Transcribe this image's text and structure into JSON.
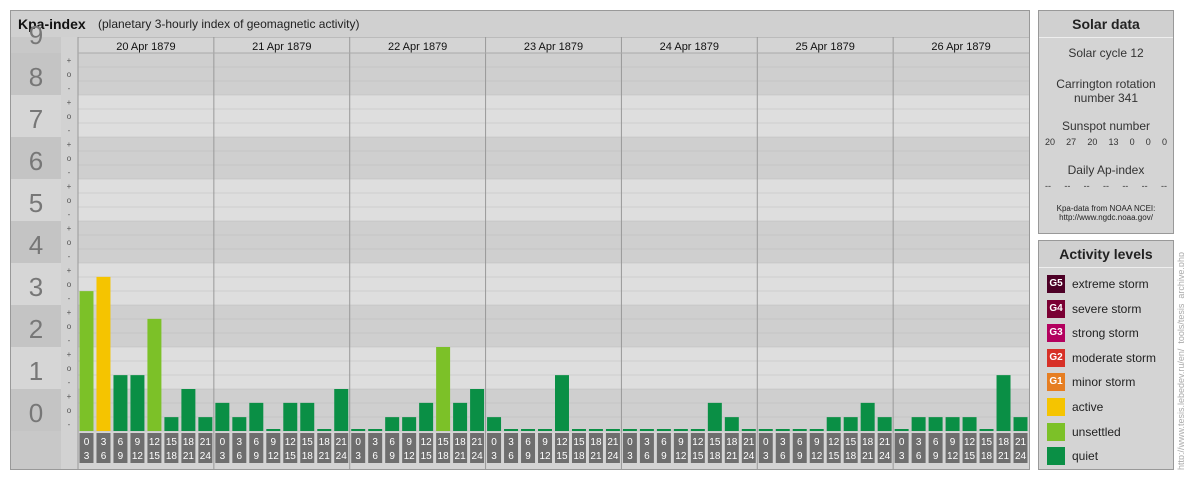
{
  "header": {
    "title": "Kpa-index",
    "subtitle": "(planetary 3-hourly index of geomagnetic activity)"
  },
  "solar": {
    "title": "Solar data",
    "cycle": "Solar cycle 12",
    "rotation_line1": "Carrington rotation",
    "rotation_line2": "number 341",
    "sunspot_title": "Sunspot number",
    "sunspot_values": [
      "20",
      "27",
      "20",
      "13",
      "0",
      "0",
      "0"
    ],
    "ap_title": "Daily Ap-index",
    "ap_values": [
      "--",
      "--",
      "--",
      "--",
      "--",
      "--",
      "--"
    ],
    "source_line1": "Kpa-data from NOAA NCEI:",
    "source_line2": "http://www.ngdc.noaa.gov/"
  },
  "legend": {
    "title": "Activity levels",
    "items": [
      {
        "code": "G5",
        "label": "extreme storm",
        "color": "#4d0026"
      },
      {
        "code": "G4",
        "label": "severe storm",
        "color": "#7a0033"
      },
      {
        "code": "G3",
        "label": "strong storm",
        "color": "#b3005e"
      },
      {
        "code": "G2",
        "label": "moderate storm",
        "color": "#d73027"
      },
      {
        "code": "G1",
        "label": "minor storm",
        "color": "#e67e22"
      },
      {
        "code": "",
        "label": "active",
        "color": "#f5c400"
      },
      {
        "code": "",
        "label": "unsettled",
        "color": "#7cc128"
      },
      {
        "code": "",
        "label": "quiet",
        "color": "#0a8f45"
      }
    ]
  },
  "credit": "http://www.tesis.lebedev.ru/en/_tools/tesis_archive.php",
  "chart_data": {
    "type": "bar",
    "title": "Kpa-index",
    "ylim": [
      0,
      9
    ],
    "y_ticks": [
      "0",
      "1",
      "2",
      "3",
      "4",
      "5",
      "6",
      "7",
      "8",
      "9"
    ],
    "minor_ticks": [
      "-",
      "o",
      "+"
    ],
    "days": [
      "20 Apr 1879",
      "21 Apr 1879",
      "22 Apr 1879",
      "23 Apr 1879",
      "24 Apr 1879",
      "25 Apr 1879",
      "26 Apr 1879"
    ],
    "hour_top": [
      "0",
      "3",
      "6",
      "9",
      "12",
      "15",
      "18",
      "21"
    ],
    "hour_bottom": [
      "3",
      "6",
      "9",
      "12",
      "15",
      "18",
      "21",
      "24"
    ],
    "values": [
      3.33,
      3.67,
      1.33,
      1.33,
      2.67,
      0.33,
      1.0,
      0.33,
      0.67,
      0.33,
      0.67,
      0.0,
      0.67,
      0.67,
      0.0,
      1.0,
      0.0,
      0.0,
      0.33,
      0.33,
      0.67,
      2.0,
      0.67,
      1.0,
      0.33,
      0.0,
      0.0,
      0.0,
      1.33,
      0.0,
      0.0,
      0.0,
      0.0,
      0.0,
      0.0,
      0.0,
      0.0,
      0.67,
      0.33,
      0.0,
      0.0,
      0.0,
      0.0,
      0.0,
      0.33,
      0.33,
      0.67,
      0.33,
      0.0,
      0.33,
      0.33,
      0.33,
      0.33,
      0.0,
      1.33,
      0.33
    ],
    "thresholds": {
      "quiet_max": 3,
      "unsettled_max": 3.5
    },
    "colors": {
      "quiet": "#0a8f45",
      "unsettled": "#7cc128",
      "active": "#f5c400"
    }
  }
}
